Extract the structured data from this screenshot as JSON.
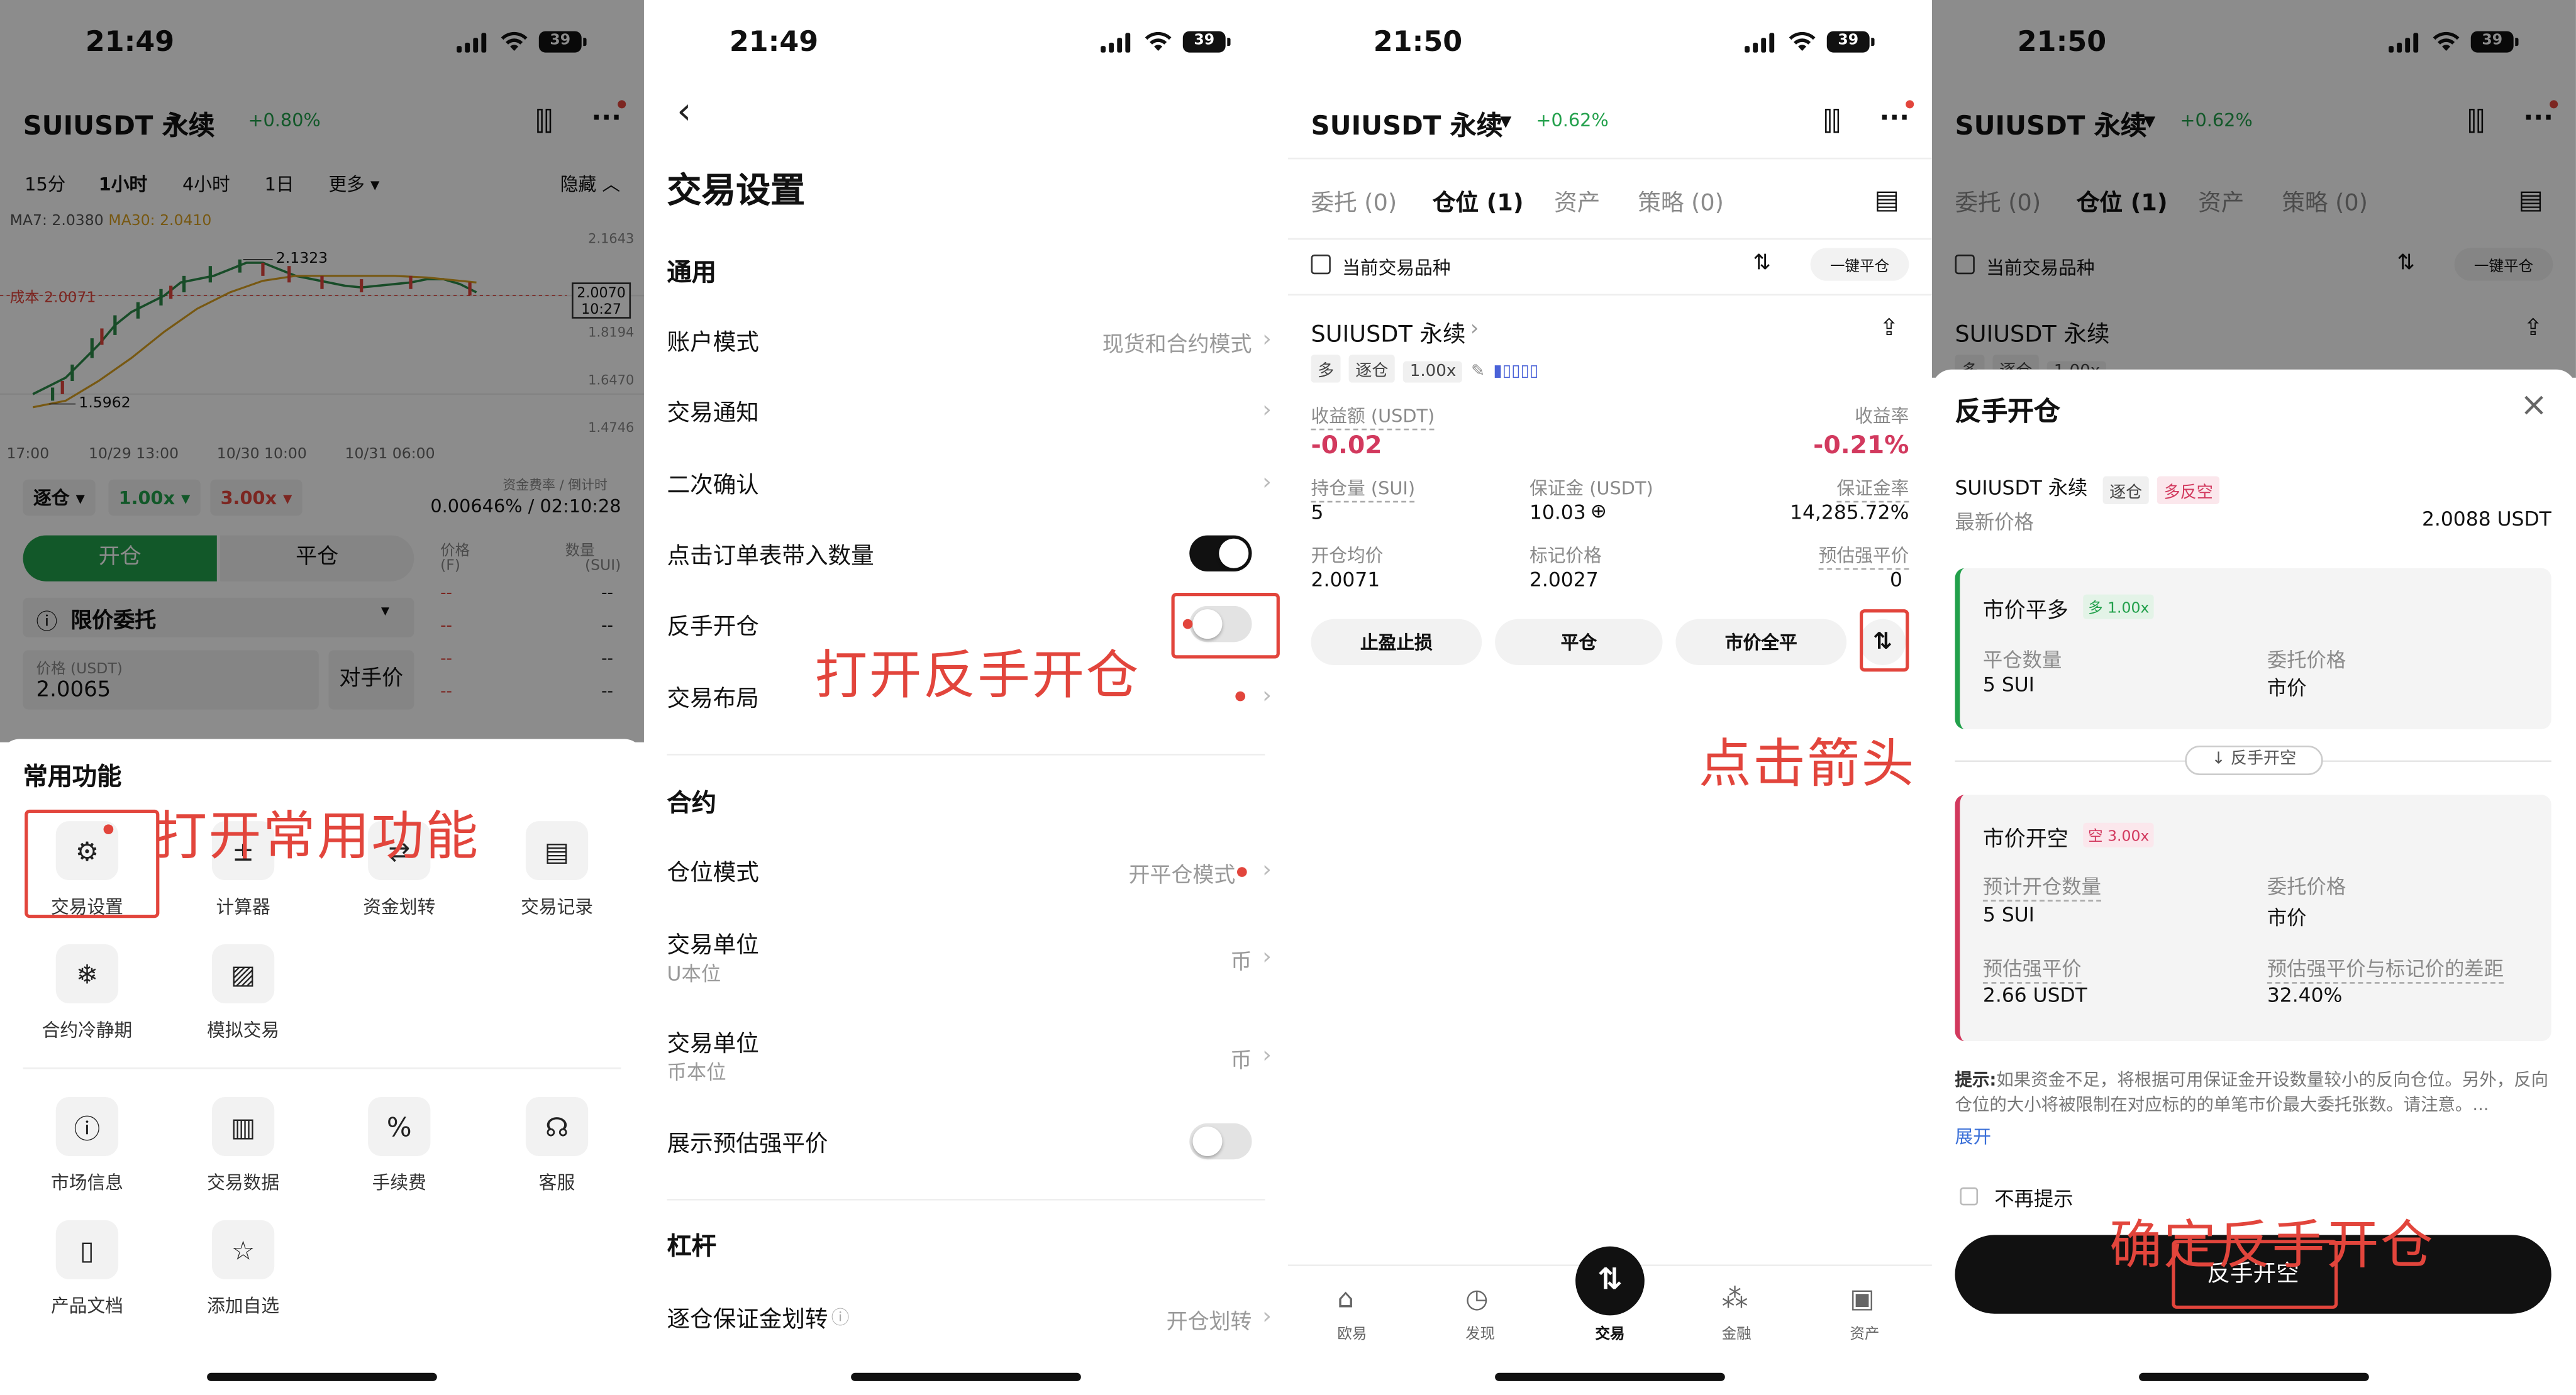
{
  "status": {
    "p1_time": "21:49",
    "p2_time": "21:49",
    "p3_time": "21:50",
    "p4_time": "21:50",
    "battery": "39"
  },
  "colors": {
    "accent_red": "#e2453c",
    "up_green": "#22a04b",
    "dark": "#111111"
  },
  "p1": {
    "symbol": "SUIUSDT 永续",
    "change": "+0.80%",
    "intervals": [
      "15分",
      "1小时",
      "4小时",
      "1日",
      "更多 ▾"
    ],
    "hide": "隐藏 ︿",
    "ma7": "MA7: 2.0380",
    "ma30": "MA30: 2.0410",
    "cost": "成本 2.0071",
    "high": "2.1323",
    "low": "1.5962",
    "price_box": [
      "2.0070",
      "10:27"
    ],
    "y_ticks": [
      "2.1643",
      "1.8194",
      "1.6470",
      "1.4746"
    ],
    "x_ticks": [
      "17:00",
      "10/29 13:00",
      "10/30 10:00",
      "10/31 06:00"
    ],
    "mode": "逐仓 ▾",
    "lev1": "1.00x ▾",
    "lev2": "3.00x ▾",
    "funding_label": "资金费率 / 倒计时",
    "funding_val": "0.00646% / 02:10:28",
    "open_btn": "开仓",
    "close_btn": "平仓",
    "col_price": "价格",
    "col_price_unit": "(F)",
    "col_qty": "数量",
    "col_qty_unit": "(SUI)",
    "order_type": "限价委托",
    "price_label": "价格 (USDT)",
    "price_val": "2.0065",
    "counter": "对手价",
    "dashes": "--",
    "sheet_title": "常用功能",
    "tools": [
      {
        "label": "交易设置",
        "icon": "gear-icon",
        "glyph": "⚙"
      },
      {
        "label": "计算器",
        "icon": "calculator-icon",
        "glyph": "±"
      },
      {
        "label": "资金划转",
        "icon": "transfer-icon",
        "glyph": "⇄"
      },
      {
        "label": "交易记录",
        "icon": "records-icon",
        "glyph": "▤"
      },
      {
        "label": "合约冷静期",
        "icon": "snowflake-icon",
        "glyph": "❄"
      },
      {
        "label": "模拟交易",
        "icon": "simulate-icon",
        "glyph": "▨"
      },
      {
        "label": "市场信息",
        "icon": "info-icon",
        "glyph": "ⓘ"
      },
      {
        "label": "交易数据",
        "icon": "data-icon",
        "glyph": "▥"
      },
      {
        "label": "手续费",
        "icon": "percent-icon",
        "glyph": "%"
      },
      {
        "label": "客服",
        "icon": "headset-icon",
        "glyph": "☊"
      },
      {
        "label": "产品文档",
        "icon": "document-icon",
        "glyph": "▯"
      },
      {
        "label": "添加自选",
        "icon": "star-icon",
        "glyph": "☆"
      }
    ],
    "annotation": "打开常用功能"
  },
  "p2": {
    "title": "交易设置",
    "general": "通用",
    "rows": [
      {
        "label": "账户模式",
        "value": "现货和合约模式"
      },
      {
        "label": "交易通知",
        "value": ""
      },
      {
        "label": "二次确认",
        "value": ""
      },
      {
        "label": "点击订单表带入数量",
        "value": ""
      },
      {
        "label": "反手开仓",
        "value": ""
      },
      {
        "label": "交易布局",
        "value": ""
      }
    ],
    "contract": "合约",
    "rows2": [
      {
        "label": "仓位模式",
        "value": "开平仓模式"
      },
      {
        "label": "交易单位",
        "sub": "U本位",
        "value": "币"
      },
      {
        "label": "交易单位",
        "sub": "币本位",
        "value": "币"
      },
      {
        "label": "展示预估强平价",
        "value": ""
      }
    ],
    "leverage": "杠杆",
    "margin_row": "逐仓保证金划转",
    "margin_val": "开仓划转",
    "annotation": "打开反手开仓"
  },
  "p3": {
    "symbol": "SUIUSDT 永续",
    "change": "+0.62%",
    "tabs": [
      "委托 (0)",
      "仓位 (1)",
      "资产",
      "策略 (0)"
    ],
    "filter": "当前交易品种",
    "close_all": "一键平仓",
    "pos_symbol": "SUIUSDT 永续",
    "tag_long": "多",
    "tag_mode": "逐仓",
    "tag_lev": "1.00x",
    "pnl_label": "收益额 (USDT)",
    "pnl_val": "-0.02",
    "roe_label": "收益率",
    "roe_val": "-0.21%",
    "hold_label": "持仓量 (SUI)",
    "hold_val": "5",
    "margin_label": "保证金 (USDT)",
    "margin_val": "10.03",
    "mratio_label": "保证金率",
    "mratio_val": "14,285.72%",
    "entry_label": "开仓均价",
    "entry_val": "2.0071",
    "mark_label": "标记价格",
    "mark_val": "2.0027",
    "liq_label": "预估强平价",
    "liq_val": "0",
    "btns": [
      "止盈止损",
      "平仓",
      "市价全平"
    ],
    "annotation": "点击箭头",
    "nav": [
      "欧易",
      "发现",
      "交易",
      "金融",
      "资产"
    ]
  },
  "p4": {
    "symbol": "SUIUSDT 永续",
    "change": "+0.62%",
    "tabs": [
      "委托 (0)",
      "仓位 (1)",
      "资产",
      "策略 (0)"
    ],
    "filter": "当前交易品种",
    "close_all": "一键平仓",
    "pos_symbol": "SUIUSDT 永续",
    "tag_long": "多",
    "tag_mode": "逐仓",
    "tag_lev": "1.00x",
    "sheet_title": "反手开仓",
    "info_symbol": "SUIUSDT 永续",
    "info_mode": "逐仓",
    "info_dir": "多反空",
    "last_label": "最新价格",
    "last_val": "2.0088 USDT",
    "c1_title": "市价平多",
    "c1_tag": "多 1.00x",
    "c1_qty_label": "平仓数量",
    "c1_qty": "5 SUI",
    "c1_price_label": "委托价格",
    "c1_price": "市价",
    "switch": "↓ 反手开空",
    "c2_title": "市价开空",
    "c2_tag": "空 3.00x",
    "c2_qty_label": "预计开仓数量",
    "c2_qty": "5 SUI",
    "c2_price_label": "委托价格",
    "c2_price": "市价",
    "c2_liq_label": "预估强平价",
    "c2_liq": "2.66 USDT",
    "c2_diff_label": "预估强平价与标记价的差距",
    "c2_diff": "32.40%",
    "tip_label": "提示:",
    "tip": "如果资金不足，将根据可用保证金开设数量较小的反向仓位。另外，反向仓位的大小将被限制在对应标的的单笔市价最大委托张数。请注意。...",
    "expand": "展开",
    "no_remind": "不再提示",
    "confirm": "反手开空",
    "annotation": "确定反手开仓"
  }
}
